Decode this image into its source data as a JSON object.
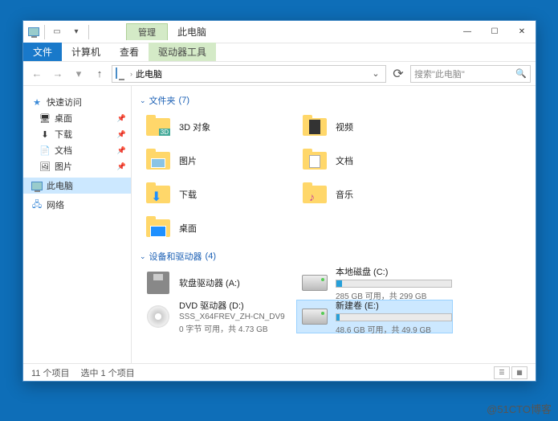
{
  "titlebar": {
    "context_tab": "管理",
    "title": "此电脑"
  },
  "ribbon": {
    "file": "文件",
    "computer": "计算机",
    "view": "查看",
    "drive_tools": "驱动器工具"
  },
  "address": {
    "location": "此电脑",
    "refresh_tip": "刷新"
  },
  "search": {
    "placeholder": "搜索\"此电脑\""
  },
  "nav": {
    "quick": "快速访问",
    "desktop": "桌面",
    "downloads": "下载",
    "documents": "文档",
    "pictures": "图片",
    "thispc": "此电脑",
    "network": "网络"
  },
  "groups": {
    "folders": {
      "label": "文件夹",
      "count": "(7)"
    },
    "drives": {
      "label": "设备和驱动器",
      "count": "(4)"
    }
  },
  "folders": {
    "objects3d": "3D 对象",
    "videos": "视频",
    "pictures": "图片",
    "documents": "文档",
    "downloads": "下载",
    "music": "音乐",
    "desktop": "桌面"
  },
  "drives": {
    "floppy": {
      "name": "软盘驱动器 (A:)"
    },
    "c": {
      "name": "本地磁盘 (C:)",
      "info": "285 GB 可用，共 299 GB",
      "pct": 5
    },
    "dvd": {
      "name": "DVD 驱动器 (D:)",
      "sub1": "SSS_X64FREV_ZH-CN_DV9",
      "sub2": "0 字节 可用，共 4.73 GB"
    },
    "e": {
      "name": "新建卷 (E:)",
      "info": "48.6 GB 可用，共 49.9 GB",
      "pct": 3
    }
  },
  "status": {
    "items": "11 个项目",
    "selected": "选中 1 个项目"
  },
  "watermark": "@51CTO博客"
}
